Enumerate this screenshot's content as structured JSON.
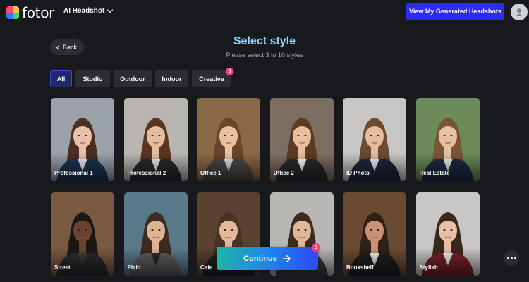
{
  "header": {
    "logo_text": "fotor",
    "nav_label": "AI Headshot",
    "cta_label": "View My Generated Headshots"
  },
  "back_label": "Back",
  "title": "Select style",
  "subtitle": "Please select 3 to 10 styles",
  "tabs": [
    {
      "label": "All",
      "active": true
    },
    {
      "label": "Studio"
    },
    {
      "label": "Outdoor"
    },
    {
      "label": "Indoor"
    },
    {
      "label": "Creative",
      "badge": "3"
    }
  ],
  "styles": [
    {
      "label": "Professional 1",
      "bg": "#9aa1a9",
      "suit": "#1e3557",
      "hair": "#4a2f22",
      "skin": "#e8c2a8",
      "shirt": "#f2f2f2"
    },
    {
      "label": "Professional 2",
      "bg": "#b9b6b1",
      "suit": "#2a2a2c",
      "hair": "#5a3522",
      "skin": "#e6bca0",
      "shirt": "#f1f1f1"
    },
    {
      "label": "Office 1",
      "bg": "#8a6a46",
      "suit": "#4d4a47",
      "hair": "#6a4527",
      "skin": "#e9c0a0",
      "shirt": "#e9e6e2"
    },
    {
      "label": "Office 2",
      "bg": "#7d6e62",
      "suit": "#2c2c2e",
      "hair": "#5e3a22",
      "skin": "#e8bea0",
      "shirt": "#ffffff"
    },
    {
      "label": "ID Photo",
      "bg": "#c7c6c4",
      "suit": "#1f2a3d",
      "hair": "#6b4a31",
      "skin": "#e3bb9f",
      "shirt": "#f4f4f4"
    },
    {
      "label": "Real Estate",
      "bg": "#6d8a5a",
      "suit": "#1f2c45",
      "hair": "#7a5534",
      "skin": "#e6c0a4",
      "shirt": "#f3f3f3"
    },
    {
      "label": "Street",
      "bg": "#7a5a40",
      "suit": "#2b2b2d",
      "hair": "#1d1714",
      "skin": "#6b4431",
      "shirt": "#3a3a3c"
    },
    {
      "label": "Plaid",
      "bg": "#5a7a8a",
      "suit": "#5e5e60",
      "hair": "#3d2a20",
      "skin": "#ddb394",
      "shirt": "#2a2a2a"
    },
    {
      "label": "Cafe",
      "bg": "#5a4330",
      "suit": "#232325",
      "hair": "#4a3222",
      "skin": "#e3b899",
      "shirt": "#f2f2f2"
    },
    {
      "label": "",
      "bg": "#b8b7b4",
      "suit": "#3c3c3e",
      "hair": "#3e2a1f",
      "skin": "#e2b89a",
      "shirt": "#f0f0f0"
    },
    {
      "label": "Bookshelf",
      "bg": "#6a4a30",
      "suit": "#202022",
      "hair": "#2f2018",
      "skin": "#c99373",
      "shirt": "#f2f2f2"
    },
    {
      "label": "Stylish",
      "bg": "#c8c7c5",
      "suit": "#7a1f2a",
      "hair": "#3a281d",
      "skin": "#e6c0a6",
      "shirt": "#f5f5f5"
    }
  ],
  "continue_label": "Continue",
  "continue_badge": "3",
  "icons": {
    "logo": "fotor-logo-icon",
    "chevron": "chevron-down-icon",
    "back": "chevron-left-icon",
    "arrow": "arrow-right-icon",
    "more": "more-icon",
    "avatar": "user-avatar-icon"
  }
}
